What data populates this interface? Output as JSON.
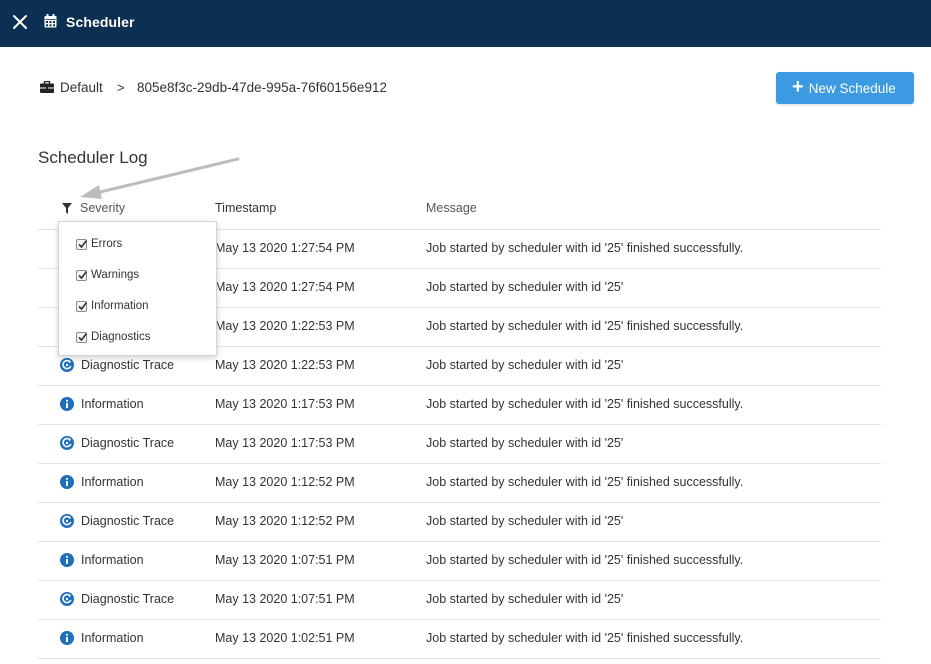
{
  "app": {
    "title": "Scheduler"
  },
  "breadcrumb": {
    "root": "Default",
    "separator": ">",
    "current": "805e8f3c-29db-47de-995a-76f60156e912"
  },
  "actions": {
    "new_schedule_label": "New Schedule",
    "new_schedule_icon": "plus-icon"
  },
  "log": {
    "title": "Scheduler Log",
    "columns": {
      "severity": "Severity",
      "timestamp": "Timestamp",
      "message": "Message"
    },
    "rows": [
      {
        "severity": "",
        "timestamp": "May 13 2020 1:27:54 PM",
        "message": "Job started by scheduler with id '25' finished successfully."
      },
      {
        "severity": "",
        "timestamp": "May 13 2020 1:27:54 PM",
        "message": "Job started by scheduler with id '25'"
      },
      {
        "severity": "",
        "timestamp": "May 13 2020 1:22:53 PM",
        "message": "Job started by scheduler with id '25' finished successfully."
      },
      {
        "severity": "Diagnostic Trace",
        "timestamp": "May 13 2020 1:22:53 PM",
        "message": "Job started by scheduler with id '25'"
      },
      {
        "severity": "Information",
        "timestamp": "May 13 2020 1:17:53 PM",
        "message": "Job started by scheduler with id '25' finished successfully."
      },
      {
        "severity": "Diagnostic Trace",
        "timestamp": "May 13 2020 1:17:53 PM",
        "message": "Job started by scheduler with id '25'"
      },
      {
        "severity": "Information",
        "timestamp": "May 13 2020 1:12:52 PM",
        "message": "Job started by scheduler with id '25' finished successfully."
      },
      {
        "severity": "Diagnostic Trace",
        "timestamp": "May 13 2020 1:12:52 PM",
        "message": "Job started by scheduler with id '25'"
      },
      {
        "severity": "Information",
        "timestamp": "May 13 2020 1:07:51 PM",
        "message": "Job started by scheduler with id '25' finished successfully."
      },
      {
        "severity": "Diagnostic Trace",
        "timestamp": "May 13 2020 1:07:51 PM",
        "message": "Job started by scheduler with id '25'"
      },
      {
        "severity": "Information",
        "timestamp": "May 13 2020 1:02:51 PM",
        "message": "Job started by scheduler with id '25' finished successfully."
      }
    ]
  },
  "severity_filter": {
    "options": [
      {
        "label": "Errors",
        "checked": true
      },
      {
        "label": "Warnings",
        "checked": true
      },
      {
        "label": "Information",
        "checked": true
      },
      {
        "label": "Diagnostics",
        "checked": true
      }
    ]
  },
  "colors": {
    "topbar": "#0d2f51",
    "accent": "#3b9ae1",
    "icon_blue": "#1f6fba"
  }
}
